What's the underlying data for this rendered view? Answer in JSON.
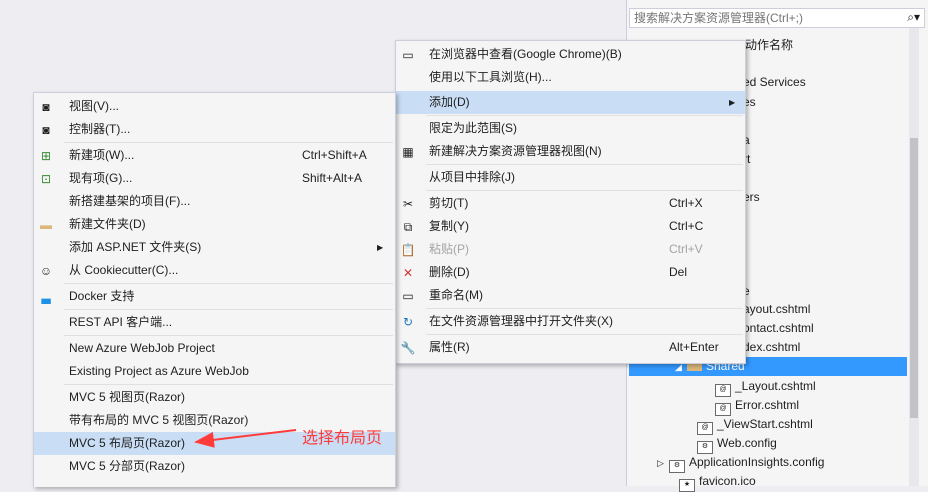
{
  "solution_explorer": {
    "search_placeholder": "搜索解决方案资源管理器(Ctrl+;)",
    "partial_labels": [
      "动作名称",
      "ed Services",
      "es",
      "a",
      "rt",
      "ers",
      "e"
    ],
    "items": [
      {
        "label": "ayout.cshtml"
      },
      {
        "label": "ontact.cshtml"
      },
      {
        "label": "dex.cshtml"
      },
      {
        "label": "Shared",
        "selected": true
      },
      {
        "label": "_Layout.cshtml"
      },
      {
        "label": "Error.cshtml"
      },
      {
        "label": "_ViewStart.cshtml"
      },
      {
        "label": "Web.config"
      },
      {
        "label": "ApplicationInsights.config"
      },
      {
        "label": "favicon.ico"
      }
    ]
  },
  "main_menu": {
    "items": [
      {
        "label": "在浏览器中查看(Google Chrome)(B)",
        "icon": "browser-icon"
      },
      {
        "label": "使用以下工具浏览(H)...",
        "icon": ""
      },
      {
        "label": "添加(D)",
        "icon": "",
        "highlighted": true,
        "submenu": true
      },
      {
        "label": "限定为此范围(S)",
        "icon": ""
      },
      {
        "label": "新建解决方案资源管理器视图(N)",
        "icon": "new-view-icon"
      },
      {
        "label": "从项目中排除(J)",
        "icon": ""
      },
      {
        "label": "剪切(T)",
        "icon": "cut-icon",
        "shortcut": "Ctrl+X"
      },
      {
        "label": "复制(Y)",
        "icon": "copy-icon",
        "shortcut": "Ctrl+C"
      },
      {
        "label": "粘贴(P)",
        "icon": "paste-icon",
        "shortcut": "Ctrl+V",
        "disabled": true
      },
      {
        "label": "删除(D)",
        "icon": "delete-icon",
        "shortcut": "Del"
      },
      {
        "label": "重命名(M)",
        "icon": "rename-icon"
      },
      {
        "label": "在文件资源管理器中打开文件夹(X)",
        "icon": "refresh-icon"
      },
      {
        "label": "属性(R)",
        "icon": "wrench-icon",
        "shortcut": "Alt+Enter"
      }
    ]
  },
  "add_menu": {
    "items": [
      {
        "label": "视图(V)...",
        "icon": "view-icon"
      },
      {
        "label": "控制器(T)...",
        "icon": "controller-icon"
      },
      {
        "label": "新建项(W)...",
        "icon": "new-item-icon",
        "shortcut": "Ctrl+Shift+A"
      },
      {
        "label": "现有项(G)...",
        "icon": "existing-item-icon",
        "shortcut": "Shift+Alt+A"
      },
      {
        "label": "新搭建基架的项目(F)...",
        "icon": ""
      },
      {
        "label": "新建文件夹(D)",
        "icon": "folder-icon"
      },
      {
        "label": "添加 ASP.NET 文件夹(S)",
        "icon": "",
        "submenu": true
      },
      {
        "label": "从 Cookiecutter(C)...",
        "icon": "cookiecutter-icon"
      },
      {
        "label": "Docker 支持",
        "icon": "docker-icon"
      },
      {
        "label": "REST API 客户端...",
        "icon": ""
      },
      {
        "label": "New Azure WebJob Project",
        "icon": ""
      },
      {
        "label": "Existing Project as Azure WebJob",
        "icon": ""
      },
      {
        "label": "MVC 5 视图页(Razor)",
        "icon": ""
      },
      {
        "label": "带有布局的 MVC 5 视图页(Razor)",
        "icon": ""
      },
      {
        "label": "MVC 5 布局页(Razor)",
        "icon": "",
        "highlighted": true
      },
      {
        "label": "MVC 5 分部页(Razor)",
        "icon": ""
      }
    ]
  },
  "annotation": {
    "text": "选择布局页",
    "color": "#ff3b3b"
  },
  "colors": {
    "highlight": "#c9def5",
    "selection": "#3399ff",
    "menu_bg": "#f5f5f5"
  }
}
